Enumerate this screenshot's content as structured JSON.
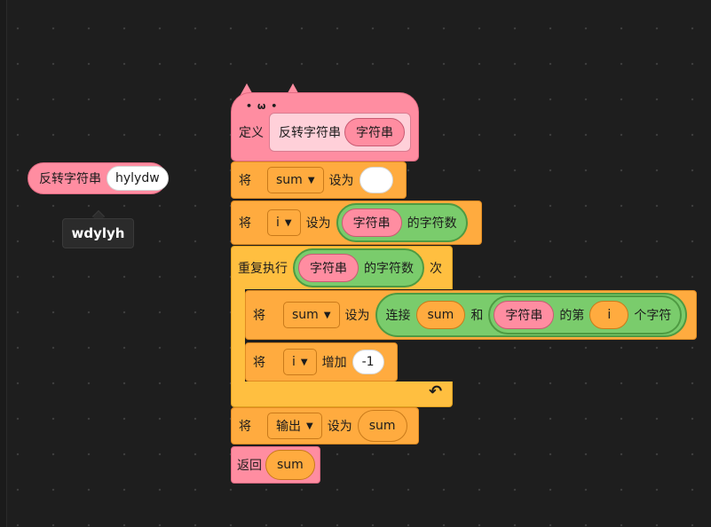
{
  "call_block": {
    "label": "反转字符串",
    "arg": "hylydw"
  },
  "tooltip": {
    "text": "wdylyh"
  },
  "define_block": {
    "cat_face": "• ω •",
    "keyword": "定义",
    "name": "反转字符串",
    "param": "字符串"
  },
  "set_empty": {
    "prefix": "将",
    "var": "sum",
    "mid": "设为",
    "value": ""
  },
  "set_i": {
    "prefix": "将",
    "var": "i",
    "mid": "设为",
    "arg": "字符串",
    "suffix": "的字符数"
  },
  "repeat": {
    "prefix": "重复执行",
    "arg": "字符串",
    "mid": "的字符数",
    "suffix": "次",
    "loop_icon": "↶"
  },
  "set_concat": {
    "prefix": "将",
    "var": "sum",
    "mid": "设为",
    "join": "连接",
    "join_a": "sum",
    "and": "和",
    "str": "字符串",
    "nth": "的第",
    "index": "i",
    "char": "个字符"
  },
  "change_i": {
    "prefix": "将",
    "var": "i",
    "mid": "增加",
    "value": "-1"
  },
  "set_output": {
    "prefix": "将",
    "var": "输出",
    "mid": "设为",
    "value": "sum"
  },
  "return_block": {
    "label": "返回",
    "value": "sum"
  },
  "colors": {
    "background": "#1e1e1e",
    "custom_block": "#ff8da1",
    "variables": "#ffab3f",
    "control": "#ffbf40",
    "operators": "#7acc6c"
  },
  "icons": {
    "dropdown": "caret-down-icon",
    "loop": "loop-arrow-icon",
    "cat_ears": "cat-ears-icon"
  }
}
